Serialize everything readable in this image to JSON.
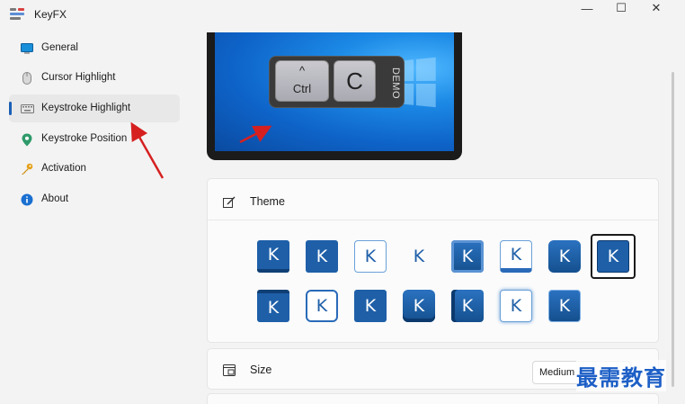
{
  "window": {
    "title": "KeyFX",
    "controls": [
      "—",
      "☐",
      "✕"
    ]
  },
  "sidebar": {
    "items": [
      {
        "label": "General",
        "icon": "monitor-icon"
      },
      {
        "label": "Cursor Highlight",
        "icon": "mouse-icon"
      },
      {
        "label": "Keystroke Highlight",
        "icon": "keyboard-icon",
        "active": true
      },
      {
        "label": "Keystroke Position",
        "icon": "location-pin-icon"
      },
      {
        "label": "Activation",
        "icon": "key-icon"
      },
      {
        "label": "About",
        "icon": "info-icon"
      }
    ]
  },
  "preview": {
    "key_modifier_symbol": "^",
    "key_modifier": "Ctrl",
    "key_main": "C",
    "demo_label": "DEMO"
  },
  "theme": {
    "title": "Theme",
    "key_letter": "K",
    "selected_index": 7,
    "styles_row1": [
      "blue-underline",
      "blue",
      "outline",
      "plain",
      "blue-shade",
      "outline-bar",
      "blue",
      "blue-selected"
    ],
    "styles_row2": [
      "blue-underline",
      "outline-double",
      "blue",
      "blue-shade",
      "blue-shade",
      "outline-glow",
      "blue-shade"
    ]
  },
  "size": {
    "title": "Size",
    "value": "Medium"
  },
  "watermark": "最需教育",
  "colors": {
    "accent": "#1a5fb4",
    "key_blue": "#1e5fa8",
    "arrow_red": "#d62020"
  }
}
